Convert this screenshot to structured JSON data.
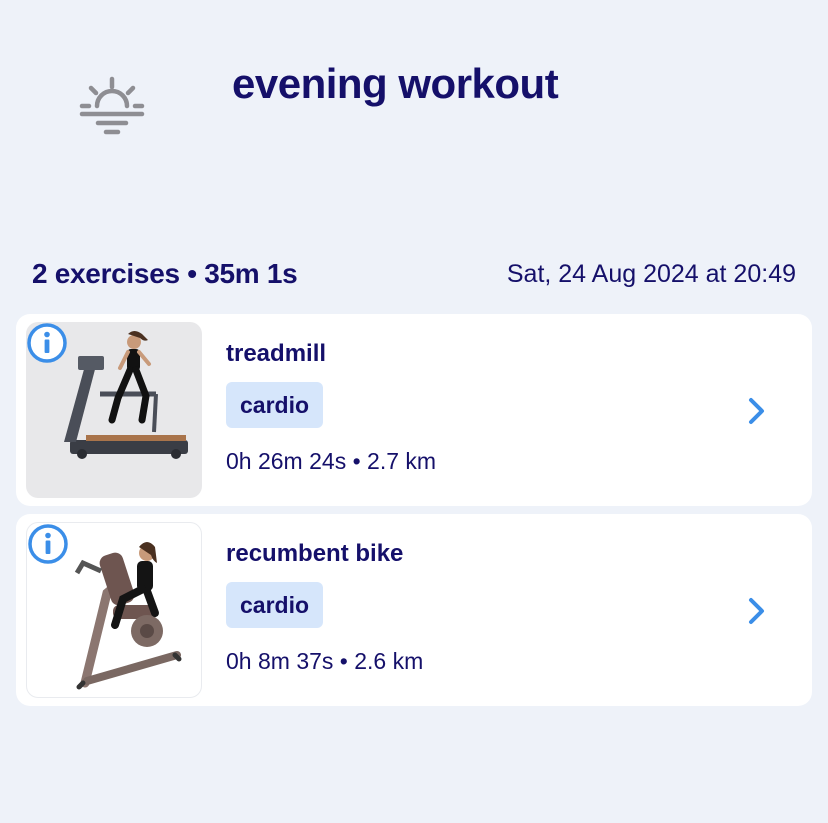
{
  "header": {
    "title": "evening workout",
    "icon": "sunset-icon"
  },
  "summary": {
    "exercises_and_duration": "2 exercises • 35m 1s",
    "date": "Sat, 24 Aug 2024 at 20:49"
  },
  "exercises": [
    {
      "name": "treadmill",
      "tag": "cardio",
      "stats": "0h 26m 24s • 2.7 km",
      "image": "treadmill-image"
    },
    {
      "name": "recumbent bike",
      "tag": "cardio",
      "stats": "0h 8m 37s • 2.6 km",
      "image": "recumbent-bike-image"
    }
  ],
  "colors": {
    "background": "#eef2f9",
    "text": "#15106a",
    "tag_background": "#d6e6fb",
    "accent": "#3b8ee8"
  }
}
